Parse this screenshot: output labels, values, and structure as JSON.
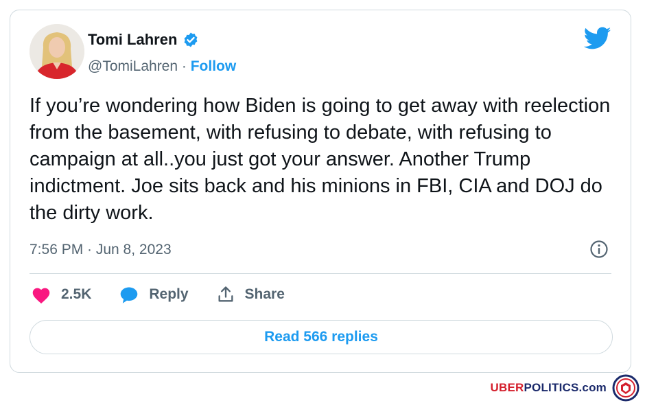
{
  "tweet": {
    "display_name": "Tomi Lahren",
    "handle": "@TomiLahren",
    "separator": " · ",
    "follow_label": "Follow",
    "text": "If you’re wondering how Biden is going to get away with reelection from the basement, with refusing to debate, with refusing to campaign at all..you just got your answer. Another Trump indictment. Joe sits back and his minions in FBI, CIA and DOJ do the dirty work.",
    "timestamp": "7:56 PM · Jun 8, 2023",
    "likes": "2.5K",
    "reply_label": "Reply",
    "share_label": "Share",
    "read_replies_label": "Read 566 replies"
  },
  "icons": {
    "verified": "verified-badge-icon",
    "bird": "twitter-bird-icon",
    "info": "info-icon",
    "heart": "heart-icon",
    "reply": "speech-bubble-icon",
    "share": "share-upload-icon"
  },
  "colors": {
    "accent": "#1d9bf0",
    "heart": "#f91880",
    "muted": "#536471",
    "text": "#0f1419",
    "border": "#cfd9de",
    "watermark_red": "#d41f2c",
    "watermark_blue": "#1b2a6b"
  },
  "watermark": {
    "part1": "UBER",
    "part2": "POLITICS.com"
  }
}
